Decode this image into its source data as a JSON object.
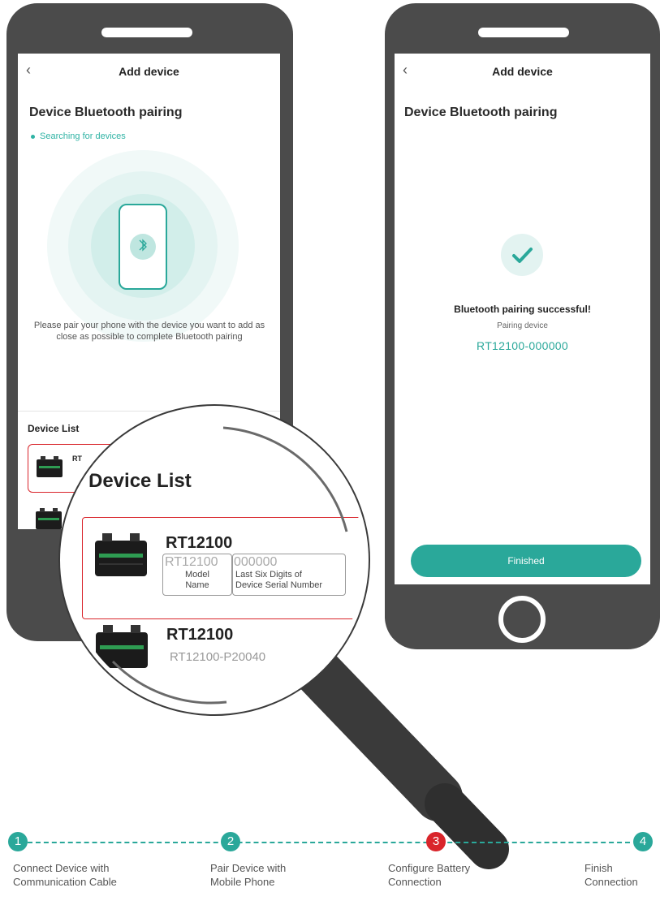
{
  "left_screen": {
    "header_title": "Add device",
    "back_icon": "chevron-left-icon",
    "section_title": "Device Bluetooth pairing",
    "status": "Searching for devices",
    "instructions": "Please pair your phone with the device you want to add as close as possible to complete Bluetooth pairing",
    "device_list_title": "Device List",
    "row_label": "RT"
  },
  "right_screen": {
    "header_title": "Add device",
    "back_icon": "chevron-left-icon",
    "section_title": "Device Bluetooth pairing",
    "success_title": "Bluetooth pairing successful!",
    "pairing_label": "Pairing device",
    "device_serial": "RT12100-000000",
    "finished_button": "Finished"
  },
  "magnifier": {
    "title": "Device List",
    "devices": [
      {
        "name": "RT12100",
        "model_part": "RT12100",
        "serial_part": "000000",
        "model_caption": "Model\nName",
        "serial_caption": "Last Six Digits of\nDevice Serial Number"
      },
      {
        "name": "RT12100",
        "model": "RT12100-P20040"
      }
    ]
  },
  "steps": [
    {
      "number": "1",
      "label": "Connect Device with\nCommunication Cable"
    },
    {
      "number": "2",
      "label": "Pair Device with\nMobile Phone"
    },
    {
      "number": "3",
      "label": "Configure Battery\nConnection"
    },
    {
      "number": "4",
      "label": "Finish\nConnection"
    }
  ],
  "colors": {
    "accent": "#2aa89a",
    "highlight": "#d9252b",
    "phone_body": "#4b4b4b"
  }
}
